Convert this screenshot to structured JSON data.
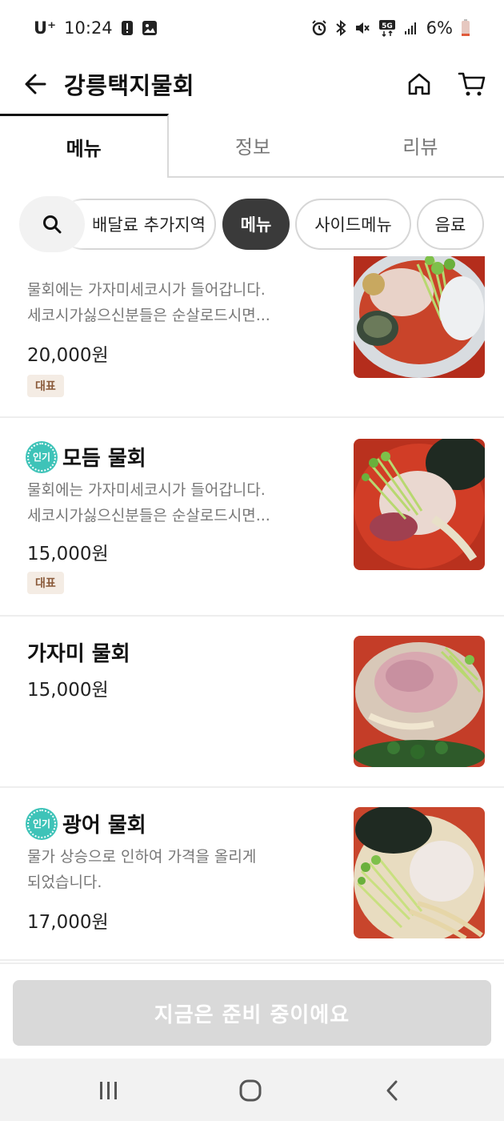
{
  "status_bar": {
    "carrier": "U⁺",
    "time": "10:24",
    "battery": "6%",
    "network": "5G"
  },
  "app_bar": {
    "title": "강릉택지물회"
  },
  "tabs": [
    {
      "label": "메뉴",
      "active": true
    },
    {
      "label": "정보",
      "active": false
    },
    {
      "label": "리뷰",
      "active": false
    }
  ],
  "chips": [
    {
      "label": "배달료 추가지역",
      "active": false
    },
    {
      "label": "메뉴",
      "active": true
    },
    {
      "label": "사이드메뉴",
      "active": false
    },
    {
      "label": "음료",
      "active": false
    }
  ],
  "menu": {
    "items": [
      {
        "name": "",
        "popular": false,
        "desc_line1": "물회에는 가자미세코시가 들어갑니다.",
        "desc_line2": "세코시가싫으신분들은 순살로드시면...",
        "price": "20,000원",
        "tag": "대표"
      },
      {
        "name": "모듬 물회",
        "popular": true,
        "popular_label": "인기",
        "desc_line1": "물회에는 가자미세코시가 들어갑니다.",
        "desc_line2": "세코시가싫으신분들은 순살로드시면...",
        "price": "15,000원",
        "tag": "대표"
      },
      {
        "name": "가자미 물회",
        "popular": false,
        "price": "15,000원"
      },
      {
        "name": "광어 물회",
        "popular": true,
        "popular_label": "인기",
        "desc_line1": "물가 상승으로 인하여 가격을 올리게",
        "desc_line2": "되었습니다.",
        "price": "17,000원"
      }
    ]
  },
  "cta": {
    "label": "지금은 준비 중이에요"
  },
  "colors": {
    "accent_popular": "#3ec3b8",
    "chip_active": "#3a3a3a",
    "cta_disabled": "#d9d9d9",
    "tag_bg": "#f4ece4",
    "tag_text": "#8a5a3a"
  }
}
